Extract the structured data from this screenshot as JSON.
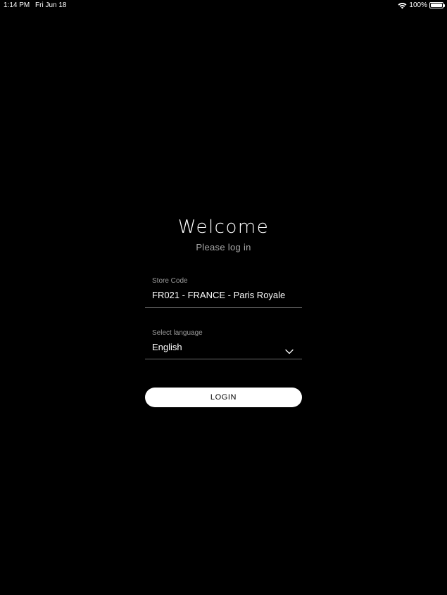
{
  "status_bar": {
    "time": "1:14 PM",
    "date": "Fri Jun 18",
    "battery_percent": "100%",
    "battery_level": 1.0,
    "wifi_icon": "wifi-icon",
    "battery_icon": "battery-icon"
  },
  "login": {
    "title": "Welcome",
    "subtitle": "Please log in",
    "store_code": {
      "label": "Store Code",
      "value": "FR021 - FRANCE - Paris Royale"
    },
    "language": {
      "label": "Select language",
      "value": "English",
      "icon": "chevron-down-icon"
    },
    "login_button_label": "LOGIN"
  },
  "colors": {
    "background": "#000000",
    "text": "#ffffff",
    "subtitle": "#a8a8a8",
    "field_label": "#9a9a9a",
    "field_underline": "#6b6b6b",
    "button_background": "#ffffff",
    "button_text": "#000000"
  }
}
